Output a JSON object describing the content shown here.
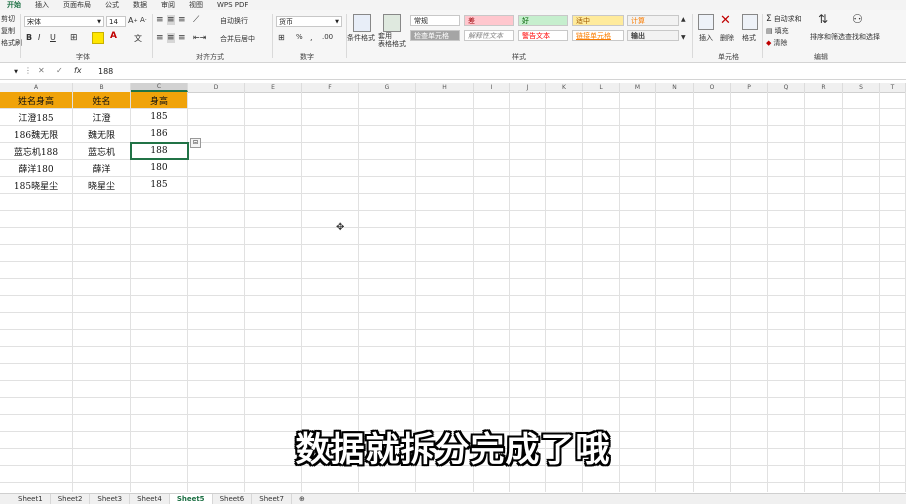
{
  "menu_tabs": [
    "开始",
    "插入",
    "页面布局",
    "公式",
    "数据",
    "审阅",
    "视图",
    "WPS PDF"
  ],
  "ribbon": {
    "clipboard": {
      "cut": "剪切",
      "copy": "复制",
      "format_painter": "格式刷"
    },
    "font": {
      "name": "宋体",
      "size": "14",
      "bold": "B",
      "italic": "I",
      "underline": "U",
      "label": "字体"
    },
    "alignment": {
      "wrap": "自动换行",
      "merge": "合并后居中",
      "label": "对齐方式"
    },
    "number": {
      "format": "货币",
      "percent": "%",
      "label": "数字"
    },
    "conditional": "条件格式",
    "table_format": "套用\n表格格式",
    "styles": {
      "label": "样式",
      "items": [
        {
          "text": "常规",
          "bg": "#ffffff",
          "fg": "#222222"
        },
        {
          "text": "差",
          "bg": "#ffc7ce",
          "fg": "#9c0006"
        },
        {
          "text": "好",
          "bg": "#c6efce",
          "fg": "#006100"
        },
        {
          "text": "适中",
          "bg": "#ffeb9c",
          "fg": "#9c5700"
        },
        {
          "text": "计算",
          "bg": "#f2f2f2",
          "fg": "#fa7d00"
        },
        {
          "text": "检查单元格",
          "bg": "#a5a5a5",
          "fg": "#ffffff"
        },
        {
          "text": "解释性文本",
          "bg": "#ffffff",
          "fg": "#7f7f7f"
        },
        {
          "text": "警告文本",
          "bg": "#ffffff",
          "fg": "#ff0000"
        },
        {
          "text": "链接单元格",
          "bg": "#ffffff",
          "fg": "#fa7d00"
        },
        {
          "text": "输出",
          "bg": "#f2f2f2",
          "fg": "#3f3f3f"
        }
      ]
    },
    "cells": {
      "insert": "插入",
      "delete": "删除",
      "format": "格式",
      "label": "单元格"
    },
    "editing": {
      "autosum": "自动求和",
      "fill": "填充",
      "clear": "清除",
      "sort": "排序和筛选",
      "find": "查找和选择",
      "label": "编辑"
    }
  },
  "formula_bar": {
    "name_box": "",
    "fx": "fx",
    "value": "188"
  },
  "columns": [
    "A",
    "B",
    "C",
    "D",
    "E",
    "F",
    "G",
    "H",
    "I",
    "J",
    "K",
    "L",
    "M",
    "N",
    "O",
    "P",
    "Q",
    "R",
    "S",
    "T"
  ],
  "table": {
    "headers": [
      "姓名身高",
      "姓名",
      "身高"
    ],
    "rows": [
      [
        "江澄185",
        "江澄",
        "185"
      ],
      [
        "186魏无限",
        "魏无限",
        "186"
      ],
      [
        "蓝忘机188",
        "蓝忘机",
        "188"
      ],
      [
        "薛洋180",
        "薛洋",
        "180"
      ],
      [
        "185晓星尘",
        "晓星尘",
        "185"
      ]
    ]
  },
  "sheets": [
    "Sheet1",
    "Sheet2",
    "Sheet3",
    "Sheet4",
    "Sheet5",
    "Sheet6",
    "Sheet7"
  ],
  "active_sheet": "Sheet5",
  "subtitle": "数据就拆分完成了哦",
  "colors": {
    "header_fill": "#f0a30a",
    "selection": "#217346",
    "accent": "#1e7145"
  }
}
